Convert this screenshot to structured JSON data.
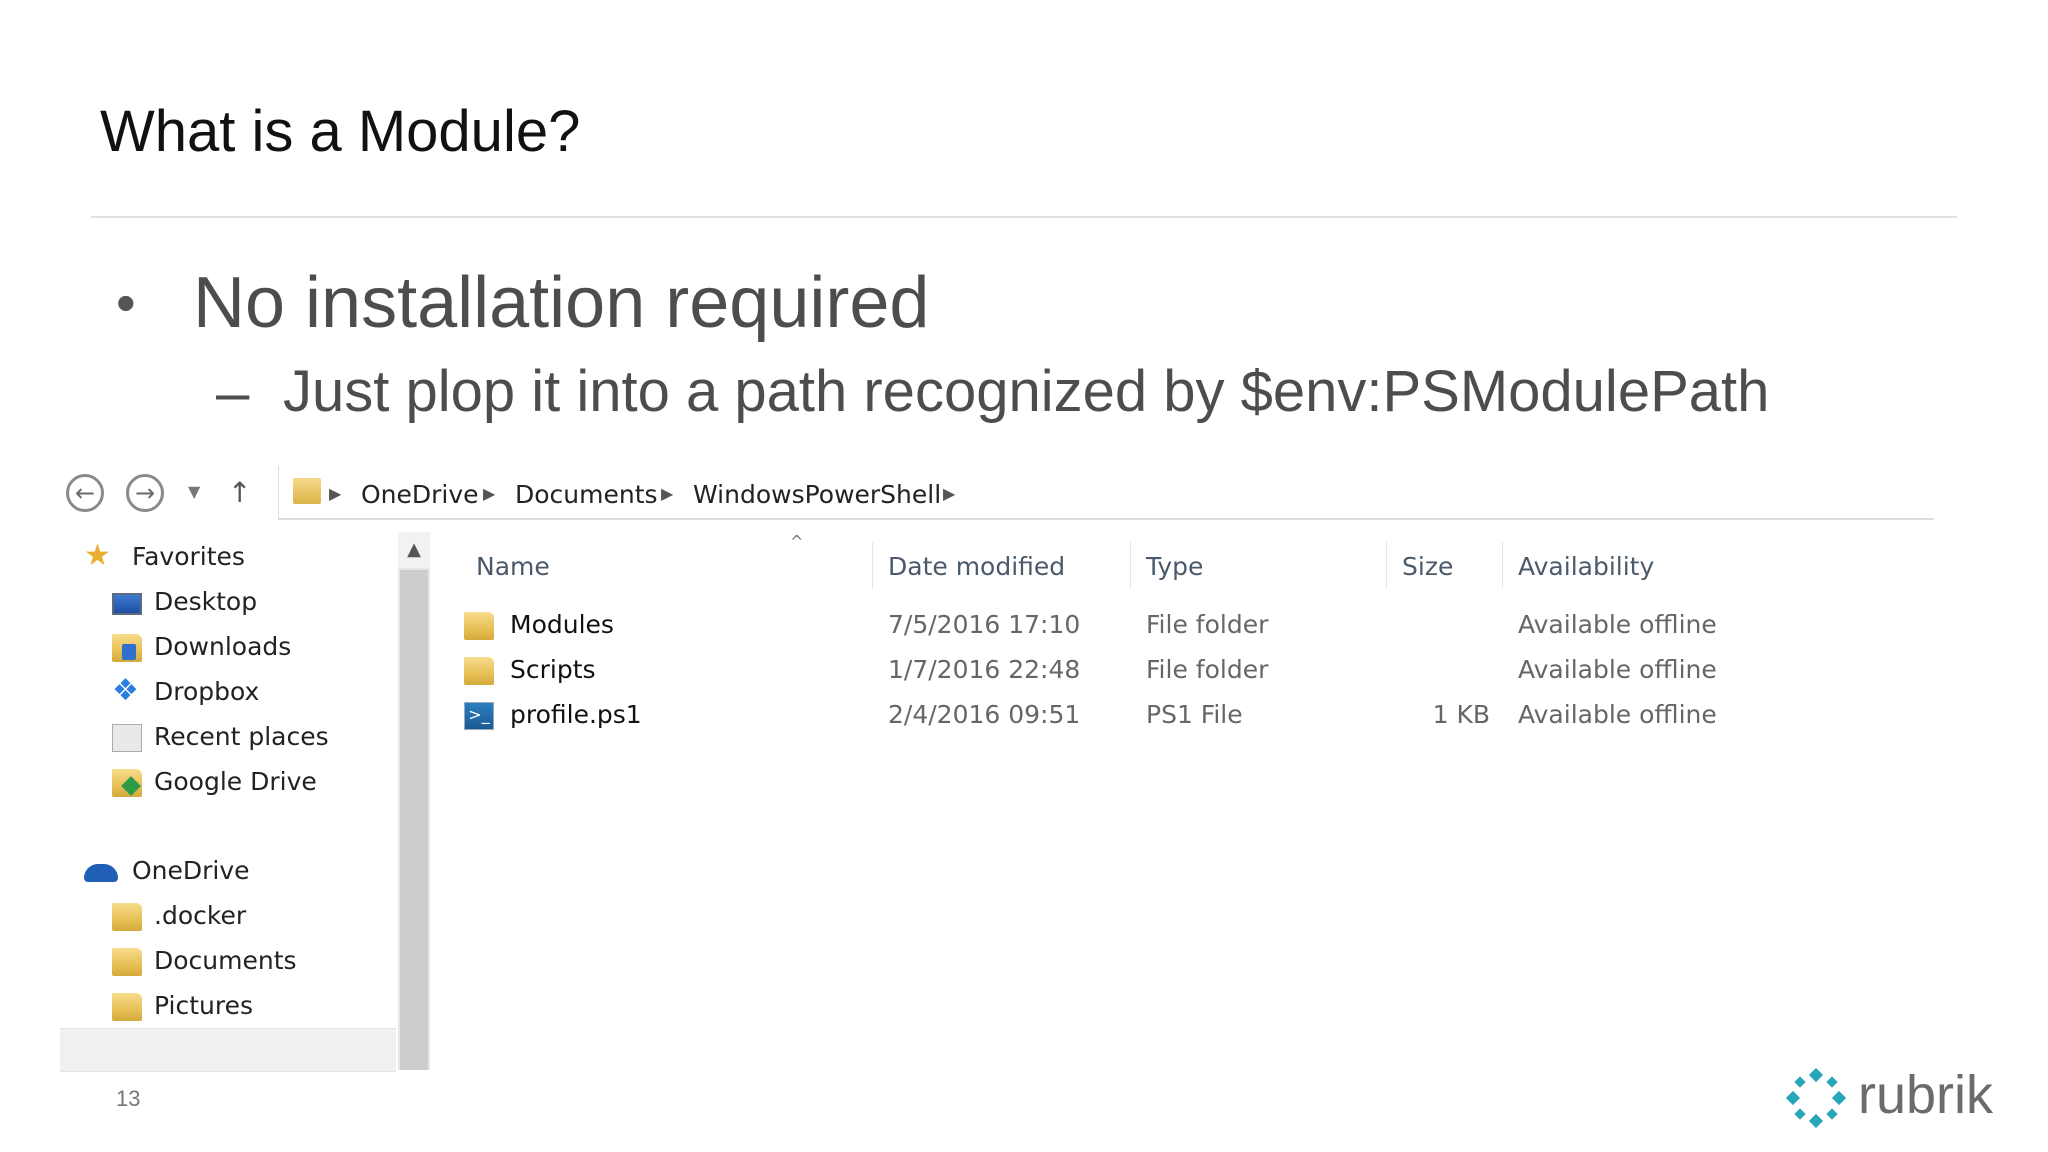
{
  "slide": {
    "title": "What is a Module?",
    "bullet": "No installation required",
    "sub_bullet": "Just plop it into a path recognized by $env:PSModulePath",
    "page_number": "13"
  },
  "explorer": {
    "breadcrumb": [
      "OneDrive",
      "Documents",
      "WindowsPowerShell"
    ],
    "nav": {
      "favorites_label": "Favorites",
      "favorites": [
        "Desktop",
        "Downloads",
        "Dropbox",
        "Recent places",
        "Google Drive"
      ],
      "onedrive_label": "OneDrive",
      "onedrive_items": [
        ".docker",
        "Documents",
        "Pictures"
      ],
      "selected": "Documents"
    },
    "columns": {
      "name": "Name",
      "date": "Date modified",
      "type": "Type",
      "size": "Size",
      "availability": "Availability"
    },
    "files": [
      {
        "name": "Modules",
        "date": "7/5/2016 17:10",
        "type": "File folder",
        "size": "",
        "availability": "Available offline",
        "icon": "folder-icon"
      },
      {
        "name": "Scripts",
        "date": "1/7/2016 22:48",
        "type": "File folder",
        "size": "",
        "availability": "Available offline",
        "icon": "folder-icon"
      },
      {
        "name": "profile.ps1",
        "date": "2/4/2016 09:51",
        "type": "PS1 File",
        "size": "1 KB",
        "availability": "Available offline",
        "icon": "powershell-file-icon"
      }
    ]
  },
  "brand": {
    "name": "rubrik",
    "color": "#26a6b8",
    "icon": "rubrik-logo-icon"
  }
}
